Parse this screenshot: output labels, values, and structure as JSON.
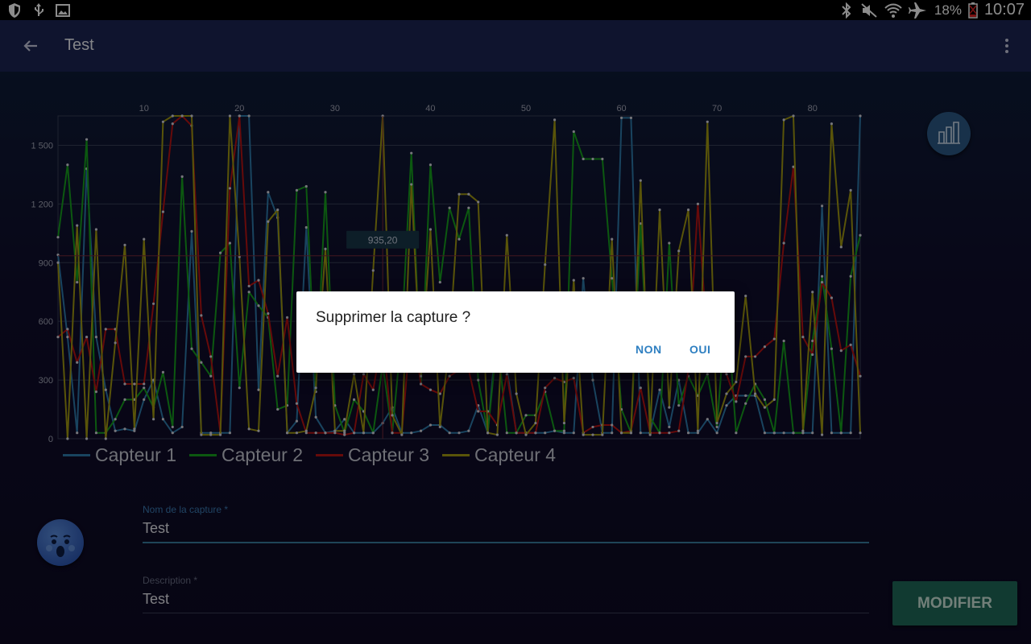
{
  "status_bar": {
    "battery": "18%",
    "time": "10:07",
    "left_icons": [
      "shield-icon",
      "usb-icon",
      "image-icon"
    ],
    "right_icons": [
      "bluetooth-icon",
      "mute-icon",
      "wifi-icon",
      "airplane-icon",
      "battery-icon"
    ]
  },
  "app_bar": {
    "title": "Test",
    "icons": [
      "back-arrow-icon",
      "more-vert-icon"
    ]
  },
  "chart_data": {
    "type": "line",
    "x_ticks": [
      10,
      20,
      30,
      40,
      50,
      60,
      70,
      80
    ],
    "y_ticks": [
      "0",
      "300",
      "600",
      "900",
      "1 200",
      "1 500"
    ],
    "ylim": [
      0,
      1650
    ],
    "xlim": [
      1,
      85
    ],
    "highlight": {
      "label": "935,20",
      "x": 35,
      "y": 935.2
    },
    "series": [
      {
        "name": "Capteur 1",
        "color": "#2f7cad",
        "values": [
          940,
          520,
          30,
          1380,
          520,
          250,
          40,
          50,
          40,
          200,
          300,
          100,
          30,
          60,
          1060,
          30,
          30,
          30,
          30,
          1650,
          1650,
          250,
          1260,
          1130,
          30,
          90,
          1080,
          110,
          30,
          40,
          100,
          30,
          30,
          30,
          80,
          160,
          30,
          30,
          40,
          70,
          70,
          30,
          30,
          40,
          170,
          30,
          600,
          360,
          30,
          30,
          30,
          30,
          40,
          30,
          30,
          820,
          300,
          30,
          30,
          1640,
          1640,
          30,
          30,
          250,
          60,
          300,
          30,
          30,
          100,
          30,
          170,
          220,
          220,
          220,
          30,
          30,
          30,
          30,
          30,
          30,
          1190,
          30,
          30,
          30,
          1650
        ]
      },
      {
        "name": "Capteur 2",
        "color": "#16a11e",
        "values": [
          1030,
          1400,
          800,
          1530,
          30,
          30,
          100,
          200,
          200,
          260,
          160,
          340,
          60,
          1340,
          460,
          390,
          320,
          950,
          1000,
          260,
          750,
          680,
          620,
          150,
          170,
          1270,
          1290,
          240,
          1260,
          170,
          30,
          200,
          140,
          30,
          380,
          30,
          550,
          1460,
          280,
          1400,
          800,
          1180,
          1020,
          1180,
          300,
          30,
          520,
          30,
          30,
          120,
          120,
          240,
          40,
          40,
          1570,
          1430,
          1430,
          1430,
          820,
          150,
          30,
          1100,
          110,
          30,
          1000,
          170,
          320,
          220,
          330,
          60,
          700,
          30,
          180,
          280,
          200,
          30,
          500,
          30,
          30,
          500,
          830,
          460,
          30,
          830,
          1040
        ]
      },
      {
        "name": "Capteur 3",
        "color": "#bb1313",
        "values": [
          520,
          560,
          390,
          520,
          240,
          560,
          560,
          280,
          280,
          280,
          690,
          1160,
          1610,
          1650,
          1600,
          630,
          420,
          30,
          1280,
          1650,
          780,
          810,
          640,
          320,
          620,
          180,
          30,
          30,
          30,
          30,
          20,
          30,
          330,
          250,
          530,
          30,
          30,
          600,
          280,
          250,
          230,
          320,
          350,
          350,
          140,
          140,
          70,
          330,
          30,
          30,
          30,
          260,
          310,
          290,
          310,
          30,
          60,
          70,
          70,
          30,
          40,
          260,
          30,
          30,
          30,
          40,
          350,
          1200,
          480,
          400,
          330,
          190,
          420,
          420,
          470,
          510,
          1000,
          1390,
          520,
          430,
          800,
          720,
          450,
          480,
          320
        ]
      },
      {
        "name": "Capteur 4",
        "color": "#a39a12",
        "values": [
          900,
          0,
          1090,
          0,
          1070,
          0,
          490,
          990,
          50,
          1020,
          100,
          1620,
          1650,
          1650,
          1650,
          20,
          20,
          20,
          1650,
          930,
          50,
          40,
          1110,
          1170,
          30,
          30,
          40,
          260,
          970,
          40,
          40,
          330,
          30,
          860,
          1650,
          120,
          20,
          1300,
          320,
          1070,
          60,
          490,
          1250,
          1250,
          1210,
          30,
          20,
          1040,
          230,
          20,
          80,
          890,
          1630,
          80,
          810,
          20,
          20,
          20,
          1020,
          30,
          30,
          1320,
          20,
          1170,
          160,
          960,
          1170,
          40,
          1620,
          80,
          230,
          290,
          730,
          230,
          160,
          200,
          1630,
          1650,
          40,
          750,
          20,
          1610,
          980,
          1270,
          30
        ]
      }
    ]
  },
  "form": {
    "name_label": "Nom de la capture *",
    "name_value": "Test",
    "description_label": "Description *",
    "description_value": "Test",
    "modify_button": "MODIFIER"
  },
  "dialog": {
    "message": "Supprimer la capture ?",
    "no_button": "NON",
    "yes_button": "OUI"
  },
  "colors": {
    "app_bar": "#1d2654",
    "accent": "#2e7fc1",
    "modify_button": "#1f6a5a"
  }
}
